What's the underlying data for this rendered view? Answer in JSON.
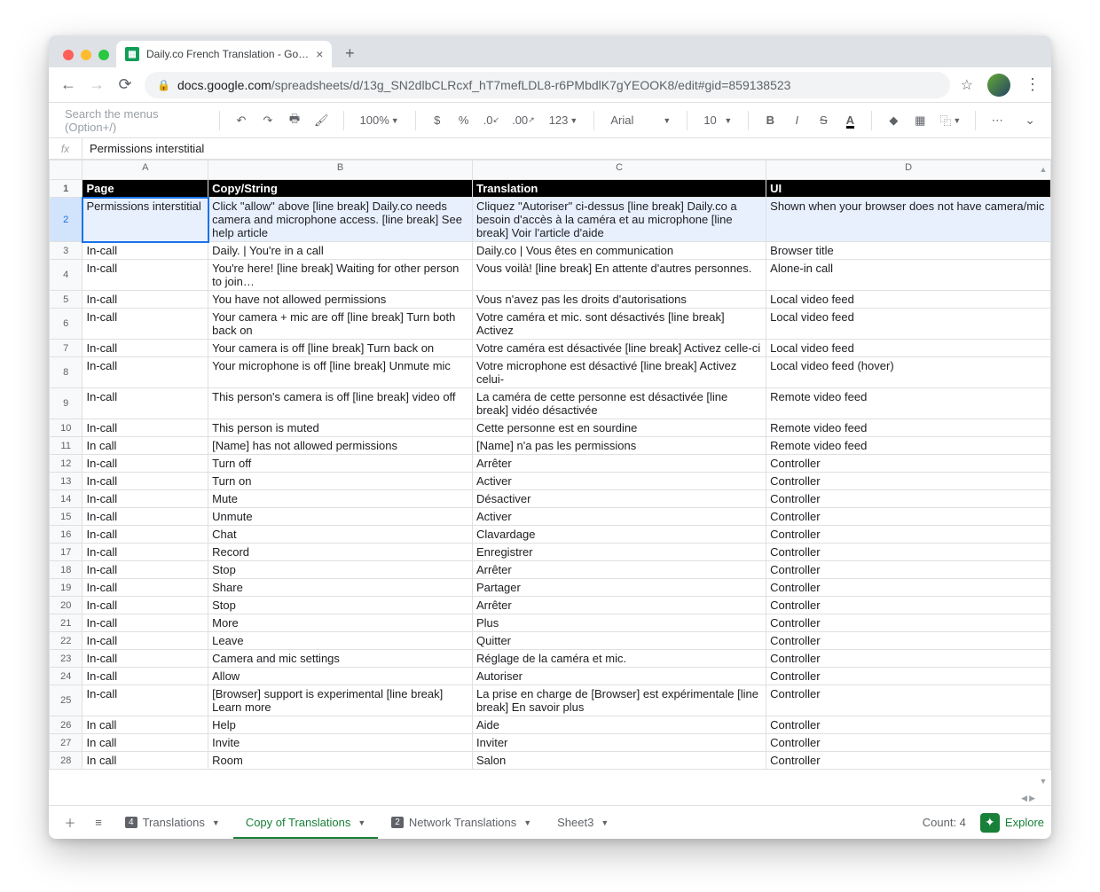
{
  "browser": {
    "tab_title": "Daily.co French Translation - Go…",
    "url_dark": "docs.google.com",
    "url_rest": "/spreadsheets/d/13g_SN2dlbCLRcxf_hT7mefLDL8-r6PMbdlK7gYEOOK8/edit#gid=859138523"
  },
  "toolbar": {
    "menu_search_placeholder": "Search the menus (Option+/)",
    "zoom": "100%",
    "currency": "$",
    "percent": "%",
    "dec_less": ".0",
    "dec_more": ".00",
    "numfmt": "123",
    "font": "Arial",
    "size": "10",
    "more": "⋯"
  },
  "formula": {
    "fx": "fx",
    "value": "Permissions interstitial"
  },
  "columns": [
    "A",
    "B",
    "C",
    "D"
  ],
  "headers": [
    "Page",
    "Copy/String",
    "Translation",
    "UI"
  ],
  "selected_row_index": 0,
  "rows": [
    {
      "n": 2,
      "a": "Permissions interstitial",
      "b": "Click \"allow\" above [line break] Daily.co needs camera and microphone access. [line break] See help article",
      "c": "Cliquez \"Autoriser\" ci-dessus [line break] Daily.co a besoin d'accès à la caméra et au microphone [line break] Voir l'article d'aide",
      "d": "Shown when your browser does not have camera/mic"
    },
    {
      "n": 3,
      "a": "In-call",
      "b": "Daily. | You're in a call",
      "c": "Daily.co | Vous êtes en communication",
      "d": "Browser title"
    },
    {
      "n": 4,
      "a": "In-call",
      "b": "You're here! [line break] Waiting for other person to join…",
      "c": "Vous voilà! [line break] En attente d'autres personnes.",
      "d": "Alone-in call"
    },
    {
      "n": 5,
      "a": "In-call",
      "b": "You have not allowed permissions",
      "c": "Vous n'avez pas les droits d'autorisations",
      "d": "Local video feed"
    },
    {
      "n": 6,
      "a": "In-call",
      "b": "Your camera + mic are off [line break] Turn both back on",
      "c": "Votre caméra et mic. sont désactivés [line break] Activez",
      "d": "Local video feed"
    },
    {
      "n": 7,
      "a": "In-call",
      "b": "Your camera is off [line break] Turn back on",
      "c": "Votre caméra est désactivée [line break] Activez celle-ci",
      "d": "Local video feed"
    },
    {
      "n": 8,
      "a": "In-call",
      "b": "Your microphone is off [line break] Unmute mic",
      "c": "Votre microphone est désactivé [line break] Activez celui-",
      "d": "Local video feed (hover)"
    },
    {
      "n": 9,
      "a": "In-call",
      "b": "This person's camera is off [line break] video off",
      "c": "La caméra de cette personne est désactivée [line break] vidéo désactivée",
      "d": "Remote video feed"
    },
    {
      "n": 10,
      "a": "In-call",
      "b": "This person is muted",
      "c": "Cette personne est en sourdine",
      "d": "Remote video feed"
    },
    {
      "n": 11,
      "a": "In call",
      "b": "[Name] has not allowed permissions",
      "c": "[Name] n'a pas les permissions",
      "d": "Remote video feed"
    },
    {
      "n": 12,
      "a": "In-call",
      "b": "Turn off",
      "c": "Arrêter",
      "d": "Controller"
    },
    {
      "n": 13,
      "a": "In-call",
      "b": "Turn on",
      "c": "Activer",
      "d": "Controller"
    },
    {
      "n": 14,
      "a": "In-call",
      "b": "Mute",
      "c": "Désactiver",
      "d": "Controller"
    },
    {
      "n": 15,
      "a": "In-call",
      "b": "Unmute",
      "c": "Activer",
      "d": "Controller"
    },
    {
      "n": 16,
      "a": "In-call",
      "b": "Chat",
      "c": "Clavardage",
      "d": "Controller"
    },
    {
      "n": 17,
      "a": "In-call",
      "b": "Record",
      "c": "Enregistrer",
      "d": "Controller"
    },
    {
      "n": 18,
      "a": "In-call",
      "b": "Stop",
      "c": "Arrêter",
      "d": "Controller"
    },
    {
      "n": 19,
      "a": "In-call",
      "b": "Share",
      "c": "Partager",
      "d": "Controller"
    },
    {
      "n": 20,
      "a": "In-call",
      "b": "Stop",
      "c": "Arrêter",
      "d": "Controller"
    },
    {
      "n": 21,
      "a": "In-call",
      "b": "More",
      "c": "Plus",
      "d": "Controller"
    },
    {
      "n": 22,
      "a": "In-call",
      "b": "Leave",
      "c": "Quitter",
      "d": "Controller"
    },
    {
      "n": 23,
      "a": "In-call",
      "b": "Camera and mic settings",
      "c": "Réglage de la caméra et mic.",
      "d": "Controller"
    },
    {
      "n": 24,
      "a": "In-call",
      "b": "Allow",
      "c": "Autoriser",
      "d": "Controller"
    },
    {
      "n": 25,
      "a": "In-call",
      "b": "[Browser] support is experimental [line break] Learn more",
      "c": "La prise en charge de [Browser] est expérimentale [line break] En savoir plus",
      "d": "Controller"
    },
    {
      "n": 26,
      "a": "In call",
      "b": "Help",
      "c": "Aide",
      "d": "Controller"
    },
    {
      "n": 27,
      "a": "In call",
      "b": "Invite",
      "c": "Inviter",
      "d": "Controller"
    },
    {
      "n": 28,
      "a": "In call",
      "b": "Room",
      "c": "Salon",
      "d": "Controller"
    }
  ],
  "sheet_tabs": {
    "t1_badge": "4",
    "t1": "Translations",
    "t2": "Copy of Translations",
    "t3_badge": "2",
    "t3": "Network Translations",
    "t4": "Sheet3"
  },
  "footer": {
    "count": "Count: 4",
    "explore": "Explore"
  }
}
